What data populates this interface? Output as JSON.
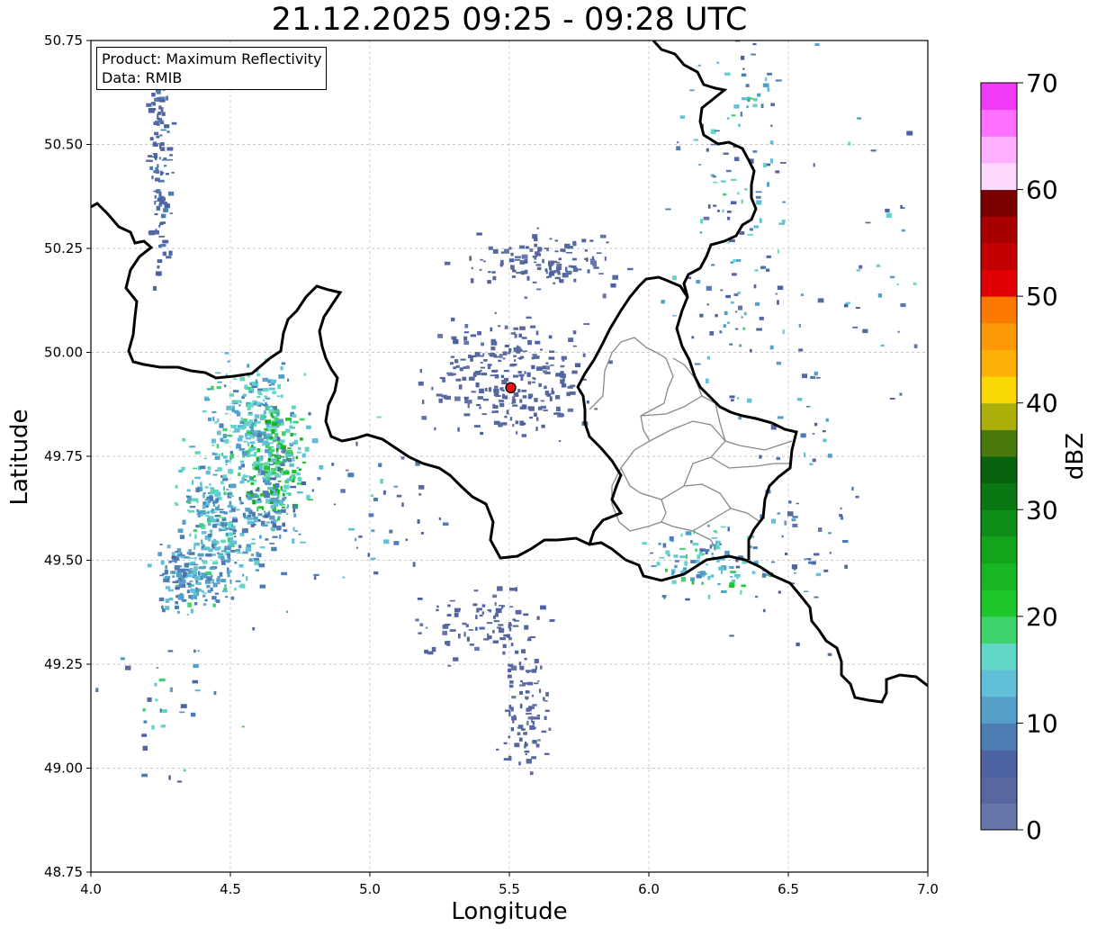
{
  "title": "21.12.2025 09:25 - 09:28 UTC",
  "info_box": {
    "product": "Product: Maximum Reflectivity",
    "data": "Data: RMIB"
  },
  "axes": {
    "xlabel": "Longitude",
    "ylabel": "Latitude",
    "xlim": [
      4.0,
      7.0
    ],
    "ylim": [
      48.75,
      50.75
    ],
    "xticks": [
      "4.0",
      "4.5",
      "5.0",
      "5.5",
      "6.0",
      "6.5",
      "7.0"
    ],
    "yticks": [
      "48.75",
      "49.00",
      "49.25",
      "49.50",
      "49.75",
      "50.00",
      "50.25",
      "50.50",
      "50.75"
    ],
    "grid": true
  },
  "colorbar": {
    "label": "dBZ",
    "ticks": [
      "0",
      "10",
      "20",
      "30",
      "40",
      "50",
      "60",
      "70"
    ],
    "range": [
      0,
      70
    ],
    "colors": [
      "#6477a8",
      "#56689f",
      "#4d62a2",
      "#4d7db3",
      "#549fc8",
      "#62bfd8",
      "#62d6c6",
      "#3fd36e",
      "#1ec72a",
      "#17b622",
      "#12a51b",
      "#0e8e16",
      "#0a7812",
      "#07620e",
      "#4a7a0c",
      "#acae0a",
      "#fad806",
      "#fdb005",
      "#fd9806",
      "#fd7a02",
      "#e00004",
      "#c50002",
      "#a80000",
      "#7a0000",
      "#ffd8ff",
      "#ffb0ff",
      "#ff70ff",
      "#f03af5"
    ]
  },
  "radar_site": {
    "lon": 5.505,
    "lat": 49.915,
    "color": "#e8141b"
  },
  "chart_data": {
    "type": "heatmap",
    "title": "21.12.2025 09:25 - 09:28 UTC",
    "xlabel": "Longitude",
    "ylabel": "Latitude",
    "xlim": [
      4.0,
      7.0
    ],
    "ylim": [
      48.75,
      50.75
    ],
    "value_label": "dBZ",
    "value_range": [
      0,
      70
    ],
    "echo_regions": [
      {
        "lon": 4.6,
        "lat": 49.82,
        "dbz": 15
      },
      {
        "lon": 4.65,
        "lat": 49.72,
        "dbz": 22
      },
      {
        "lon": 4.42,
        "lat": 49.58,
        "dbz": 14
      },
      {
        "lon": 4.38,
        "lat": 49.5,
        "dbz": 12
      },
      {
        "lon": 4.25,
        "lat": 50.4,
        "dbz": 6
      },
      {
        "lon": 5.5,
        "lat": 49.95,
        "dbz": 4
      },
      {
        "lon": 5.5,
        "lat": 49.1,
        "dbz": 5
      },
      {
        "lon": 6.4,
        "lat": 50.3,
        "dbz": 18
      },
      {
        "lon": 6.1,
        "lat": 49.45,
        "dbz": 16
      }
    ]
  }
}
